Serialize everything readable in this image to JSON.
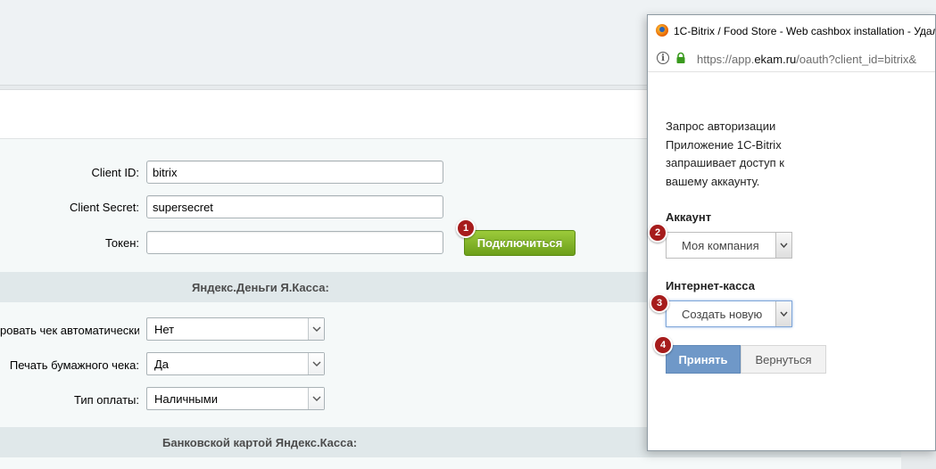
{
  "form": {
    "client_id_label": "Client ID:",
    "client_id_value": "bitrix",
    "client_secret_label": "Client Secret:",
    "client_secret_value": "supersecret",
    "token_label": "Токен:",
    "token_value": "",
    "connect_button": "Подключиться"
  },
  "sections": {
    "yandex_money": "Яндекс.Деньги  Я.Касса:",
    "bank_card": "Банковской картой Яндекс.Касса:"
  },
  "settings": {
    "auto_receipt_label": "ровать чек автоматически:",
    "auto_receipt_value": "Нет",
    "paper_receipt_label": "Печать бумажного чека:",
    "paper_receipt_value": "Да",
    "payment_type_label": "Тип оплаты:",
    "payment_type_value": "Наличными"
  },
  "badges": [
    "1",
    "2",
    "3",
    "4"
  ],
  "popup": {
    "window_title": "1C-Bitrix / Food Store - Web cashbox installation - Удалі",
    "url_prefix": "https://app.",
    "url_domain": "ekam.ru",
    "url_suffix": "/oauth?client_id=bitrix&",
    "auth_title": "Запрос авторизации",
    "auth_message": "Приложение 1C-Bitrix запрашивает доступ к вашему аккаунту.",
    "account_label": "Аккаунт",
    "account_value": "Моя компания",
    "cashbox_label": "Интернет-касса",
    "cashbox_value": "Создать новую",
    "accept_button": "Принять",
    "back_button": "Вернуться"
  },
  "colors": {
    "badge": "#a61c1c",
    "connect_button": "#7eb02a",
    "accept_button": "#6f98c8",
    "section_bar": "#e0e8ea"
  },
  "icons": {
    "browser": "firefox-icon",
    "info": "info-icon",
    "lock": "lock-icon",
    "dropdown": "chevron-down-icon"
  }
}
